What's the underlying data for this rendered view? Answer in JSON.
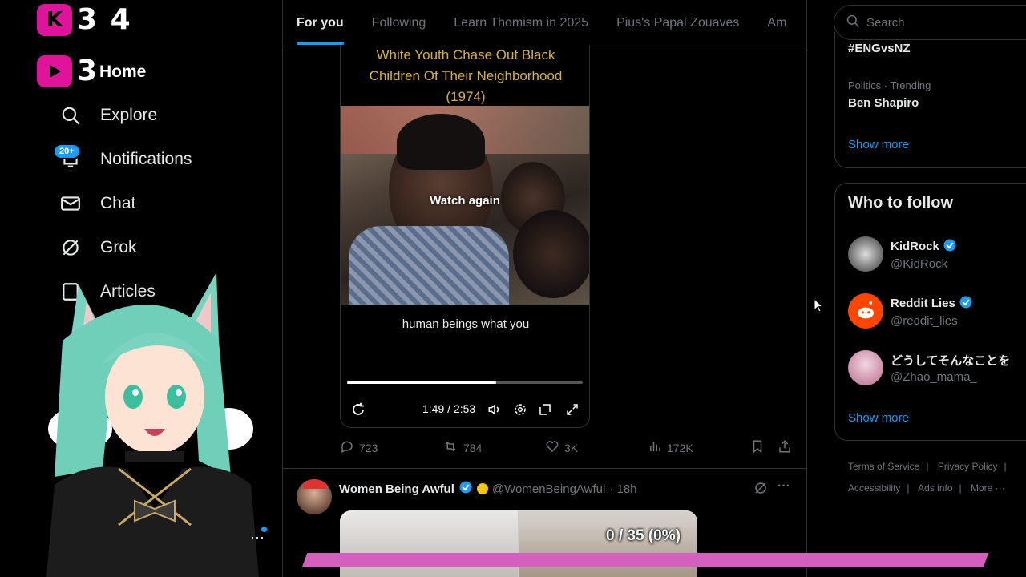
{
  "overlay": {
    "counter1_value": "3 4",
    "counter2_value": "3",
    "stream_progress_label": "0 / 35 (0%)",
    "stream_progress_fraction": 0
  },
  "nav": {
    "home": "Home",
    "explore": "Explore",
    "notifications": "Notifications",
    "notifications_badge": "20+",
    "chat": "Chat",
    "grok": "Grok",
    "articles": "Articles"
  },
  "tabs": [
    "For you",
    "Following",
    "Learn Thomism in 2025",
    "Pius's Papal Zouaves",
    "Am"
  ],
  "video": {
    "title_lines": [
      "White Youth Chase Out Black",
      "Children Of Their Neighborhood",
      "(1974)"
    ],
    "overlay_text": "Watch again",
    "caption": "human beings what you",
    "time": "1:49 / 2:53",
    "progress_fraction": 0.633
  },
  "tweet1_actions": {
    "replies": "723",
    "reposts": "784",
    "likes": "3K",
    "views": "172K"
  },
  "tweet2": {
    "name": "Women Being Awful",
    "handle": "@WomenBeingAwful",
    "time": "· 18h"
  },
  "search": {
    "placeholder": "Search"
  },
  "trends": {
    "hashtag": "#ENGvsNZ",
    "category": "Politics · Trending",
    "name": "Ben Shapiro",
    "show_more": "Show more"
  },
  "who_to_follow": {
    "title": "Who to follow",
    "accounts": [
      {
        "name": "KidRock",
        "handle": "@KidRock",
        "verified": true
      },
      {
        "name": "Reddit Lies",
        "handle": "@reddit_lies",
        "verified": true
      },
      {
        "name": "どうしてそんなことを",
        "handle": "@Zhao_mama_",
        "verified": false
      }
    ],
    "show_more": "Show more"
  },
  "footer": {
    "terms": "Terms of Service",
    "privacy": "Privacy Policy",
    "accessibility": "Accessibility",
    "ads_info": "Ads info",
    "more": "More ···"
  },
  "colors": {
    "accent": "#1d9bf0",
    "background": "#000000",
    "border": "#2f3336",
    "muted_text": "#71767b",
    "overlay_pink": "#e0149a",
    "stream_bar": "#d45fbf",
    "video_title": "#d6b04a"
  },
  "icons": [
    "search-icon",
    "bell-icon",
    "mail-icon",
    "grok-icon",
    "reply-icon",
    "repost-icon",
    "like-icon",
    "views-icon",
    "bookmark-icon",
    "share-icon",
    "replay-icon",
    "volume-icon",
    "settings-icon",
    "pip-icon",
    "fullscreen-icon",
    "verified-icon",
    "more-icon"
  ]
}
